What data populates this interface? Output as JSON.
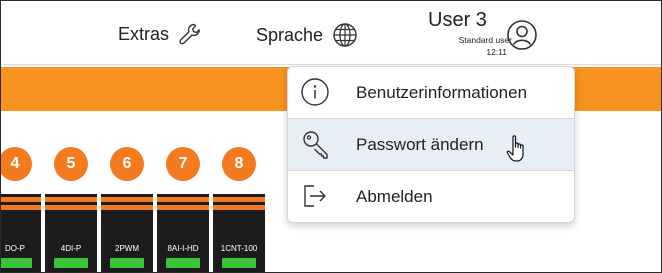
{
  "header": {
    "extras_label": "Extras",
    "language_label": "Sprache",
    "user": {
      "name": "User 3",
      "role": "Standard user",
      "time": "12:11"
    }
  },
  "slot_numbers": [
    "4",
    "5",
    "6",
    "7",
    "8"
  ],
  "modules": [
    {
      "label": "DO-P"
    },
    {
      "label": "4DI-P"
    },
    {
      "label": "2PWM"
    },
    {
      "label": "8AI-I-HD"
    },
    {
      "label": "1CNT-100"
    }
  ],
  "user_menu": {
    "items": [
      {
        "label": "Benutzerinformationen",
        "icon": "info-icon"
      },
      {
        "label": "Passwort ändern",
        "icon": "key-icon"
      },
      {
        "label": "Abmelden",
        "icon": "logout-icon"
      }
    ]
  },
  "colors": {
    "accent_orange": "#f7931e",
    "slot_orange": "#f47a20",
    "module_dark": "#1c1c1c",
    "led_green": "#3ac43a",
    "menu_hover": "#e7eef6"
  }
}
